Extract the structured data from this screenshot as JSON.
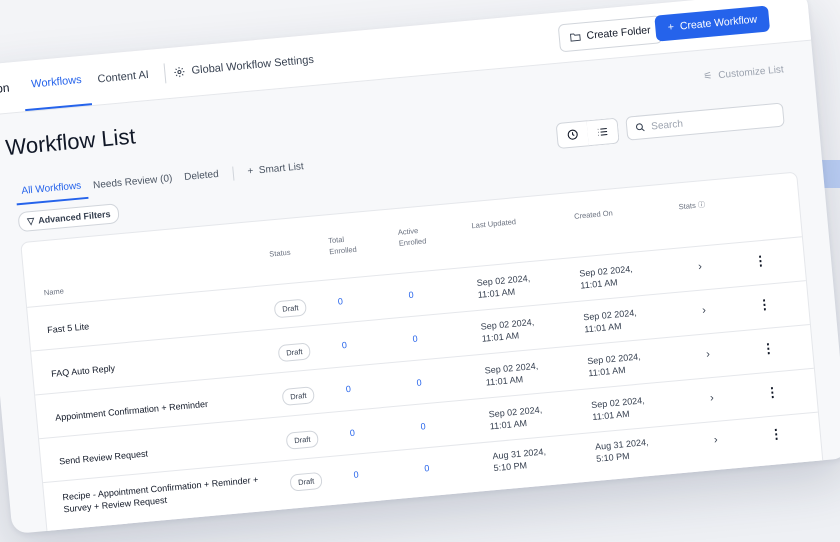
{
  "nav": {
    "crumb": "tion",
    "tabs": [
      {
        "label": "Workflows",
        "active": true
      },
      {
        "label": "Content AI",
        "active": false
      }
    ],
    "global_settings": "Global Workflow Settings",
    "create_folder": "Create Folder",
    "create_workflow": "Create Workflow"
  },
  "page": {
    "title": "Workflow List",
    "customize": "Customize List",
    "subtabs": [
      "All Workflows",
      "Needs Review (0)",
      "Deleted"
    ],
    "smart_list": "Smart List",
    "search_placeholder": "Search",
    "advanced_filters": "Advanced Filters"
  },
  "table": {
    "headers": {
      "name": "Name",
      "status": "Status",
      "total": "Total\nEnrolled",
      "active": "Active\nEnrolled",
      "updated": "Last Updated",
      "created": "Created On",
      "stats": "Stats ⓘ"
    },
    "rows": [
      {
        "name": "Fast 5 Lite",
        "status": "Draft",
        "total": "0",
        "active": "0",
        "updated": "Sep 02 2024,\n11:01 AM",
        "created": "Sep 02 2024,\n11:01 AM"
      },
      {
        "name": "FAQ Auto Reply",
        "status": "Draft",
        "total": "0",
        "active": "0",
        "updated": "Sep 02 2024,\n11:01 AM",
        "created": "Sep 02 2024,\n11:01 AM"
      },
      {
        "name": "Appointment Confirmation + Reminder",
        "status": "Draft",
        "total": "0",
        "active": "0",
        "updated": "Sep 02 2024,\n11:01 AM",
        "created": "Sep 02 2024,\n11:01 AM"
      },
      {
        "name": "Send Review Request",
        "status": "Draft",
        "total": "0",
        "active": "0",
        "updated": "Sep 02 2024,\n11:01 AM",
        "created": "Sep 02 2024,\n11:01 AM"
      },
      {
        "name": "Recipe - Appointment Confirmation + Reminder +\nSurvey + Review Request",
        "status": "Draft",
        "total": "0",
        "active": "0",
        "updated": "Aug 31 2024,\n5:10 PM",
        "created": "Aug 31 2024,\n5:10 PM"
      }
    ]
  },
  "colors": {
    "accent": "#2563eb",
    "bg": "#f7f8fa",
    "border": "#e5e7eb"
  }
}
